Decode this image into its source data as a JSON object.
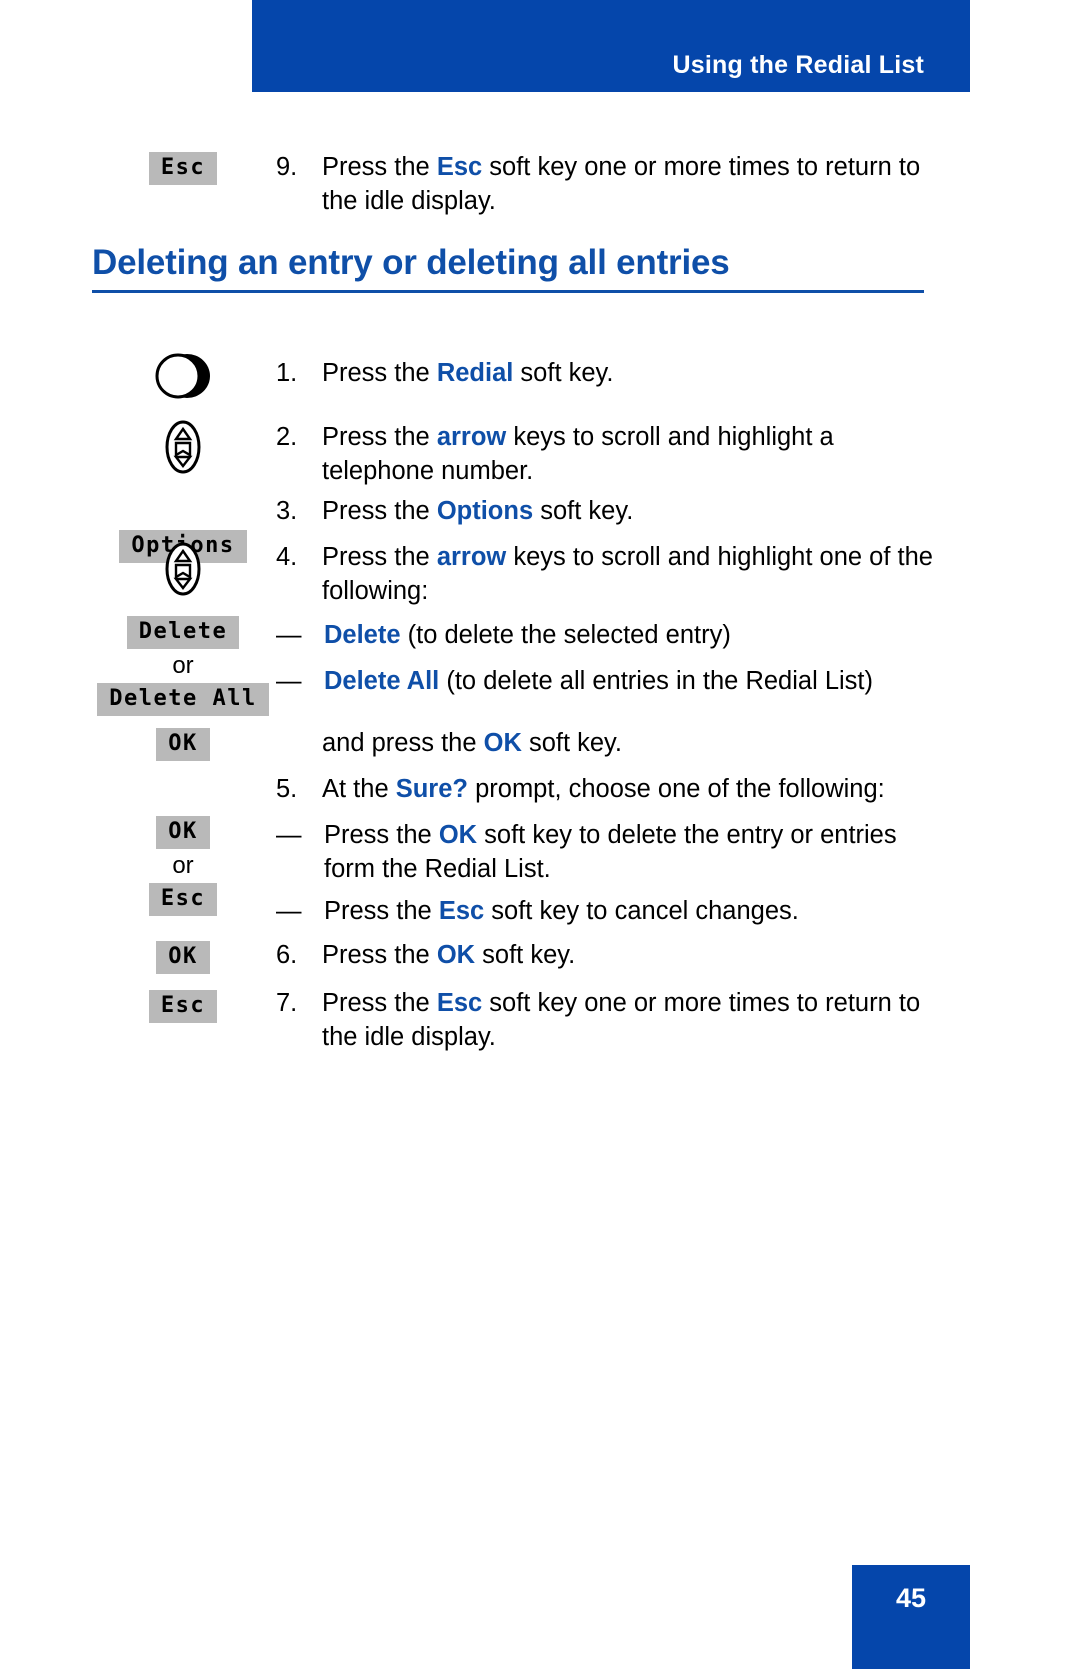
{
  "header": {
    "title": "Using the Redial List",
    "bar_color": "#0546ab"
  },
  "heading": {
    "text": "Deleting an entry or deleting all entries",
    "color": "#0f4fa8"
  },
  "footer": {
    "page_number": "45",
    "bar_color": "#0546ab"
  },
  "labels": {
    "or": "or"
  },
  "softkeys": {
    "esc": "Esc",
    "options": "Options",
    "delete": "Delete",
    "delete_all": "Delete All",
    "ok": "OK"
  },
  "icons": {
    "phone_key": "phone-key-icon",
    "navigation_key": "navigation-arrow-key-icon"
  },
  "steps": [
    {
      "number": "9.",
      "prefix": "Press the ",
      "keyword": "Esc",
      "suffix": " soft key one or more times to return to the idle display."
    },
    {
      "number": "1.",
      "prefix": "Press the ",
      "keyword": "Redial",
      "suffix": " soft key."
    },
    {
      "number": "2.",
      "prefix": "Press the ",
      "keyword": "arrow",
      "suffix": " keys to scroll and highlight a telephone number."
    },
    {
      "number": "3.",
      "prefix": "Press the ",
      "keyword": "Options",
      "suffix": " soft key."
    },
    {
      "number": "4.",
      "prefix": "Press the ",
      "keyword": "arrow",
      "suffix": " keys to scroll and highlight one of the following:"
    },
    {
      "number": "5.",
      "prefix": "At the ",
      "keyword": "Sure?",
      "suffix": " prompt, choose one of the following:"
    },
    {
      "number": "6.",
      "prefix": "Press the ",
      "keyword": "OK",
      "suffix": " soft key."
    },
    {
      "number": "7.",
      "prefix": "Press the ",
      "keyword": "Esc",
      "suffix": " soft key one or more times to return to the idle display."
    }
  ],
  "sub_items": {
    "delete_option": {
      "dash": "—",
      "keyword": "Delete",
      "suffix": " (to delete the selected entry)"
    },
    "delete_all_option": {
      "dash": "—",
      "keyword": "Delete All",
      "suffix": " (to delete all entries in the Redial List)"
    },
    "and_press_ok": {
      "prefix": "and press the ",
      "keyword": "OK",
      "suffix": " soft key."
    },
    "ok_choice": {
      "dash": "—",
      "prefix": "Press the ",
      "keyword": "OK",
      "suffix": " soft key to delete the entry or entries form the Redial List."
    },
    "esc_choice": {
      "dash": "—",
      "prefix": "Press the ",
      "keyword": "Esc",
      "suffix": " soft key to cancel changes."
    }
  }
}
